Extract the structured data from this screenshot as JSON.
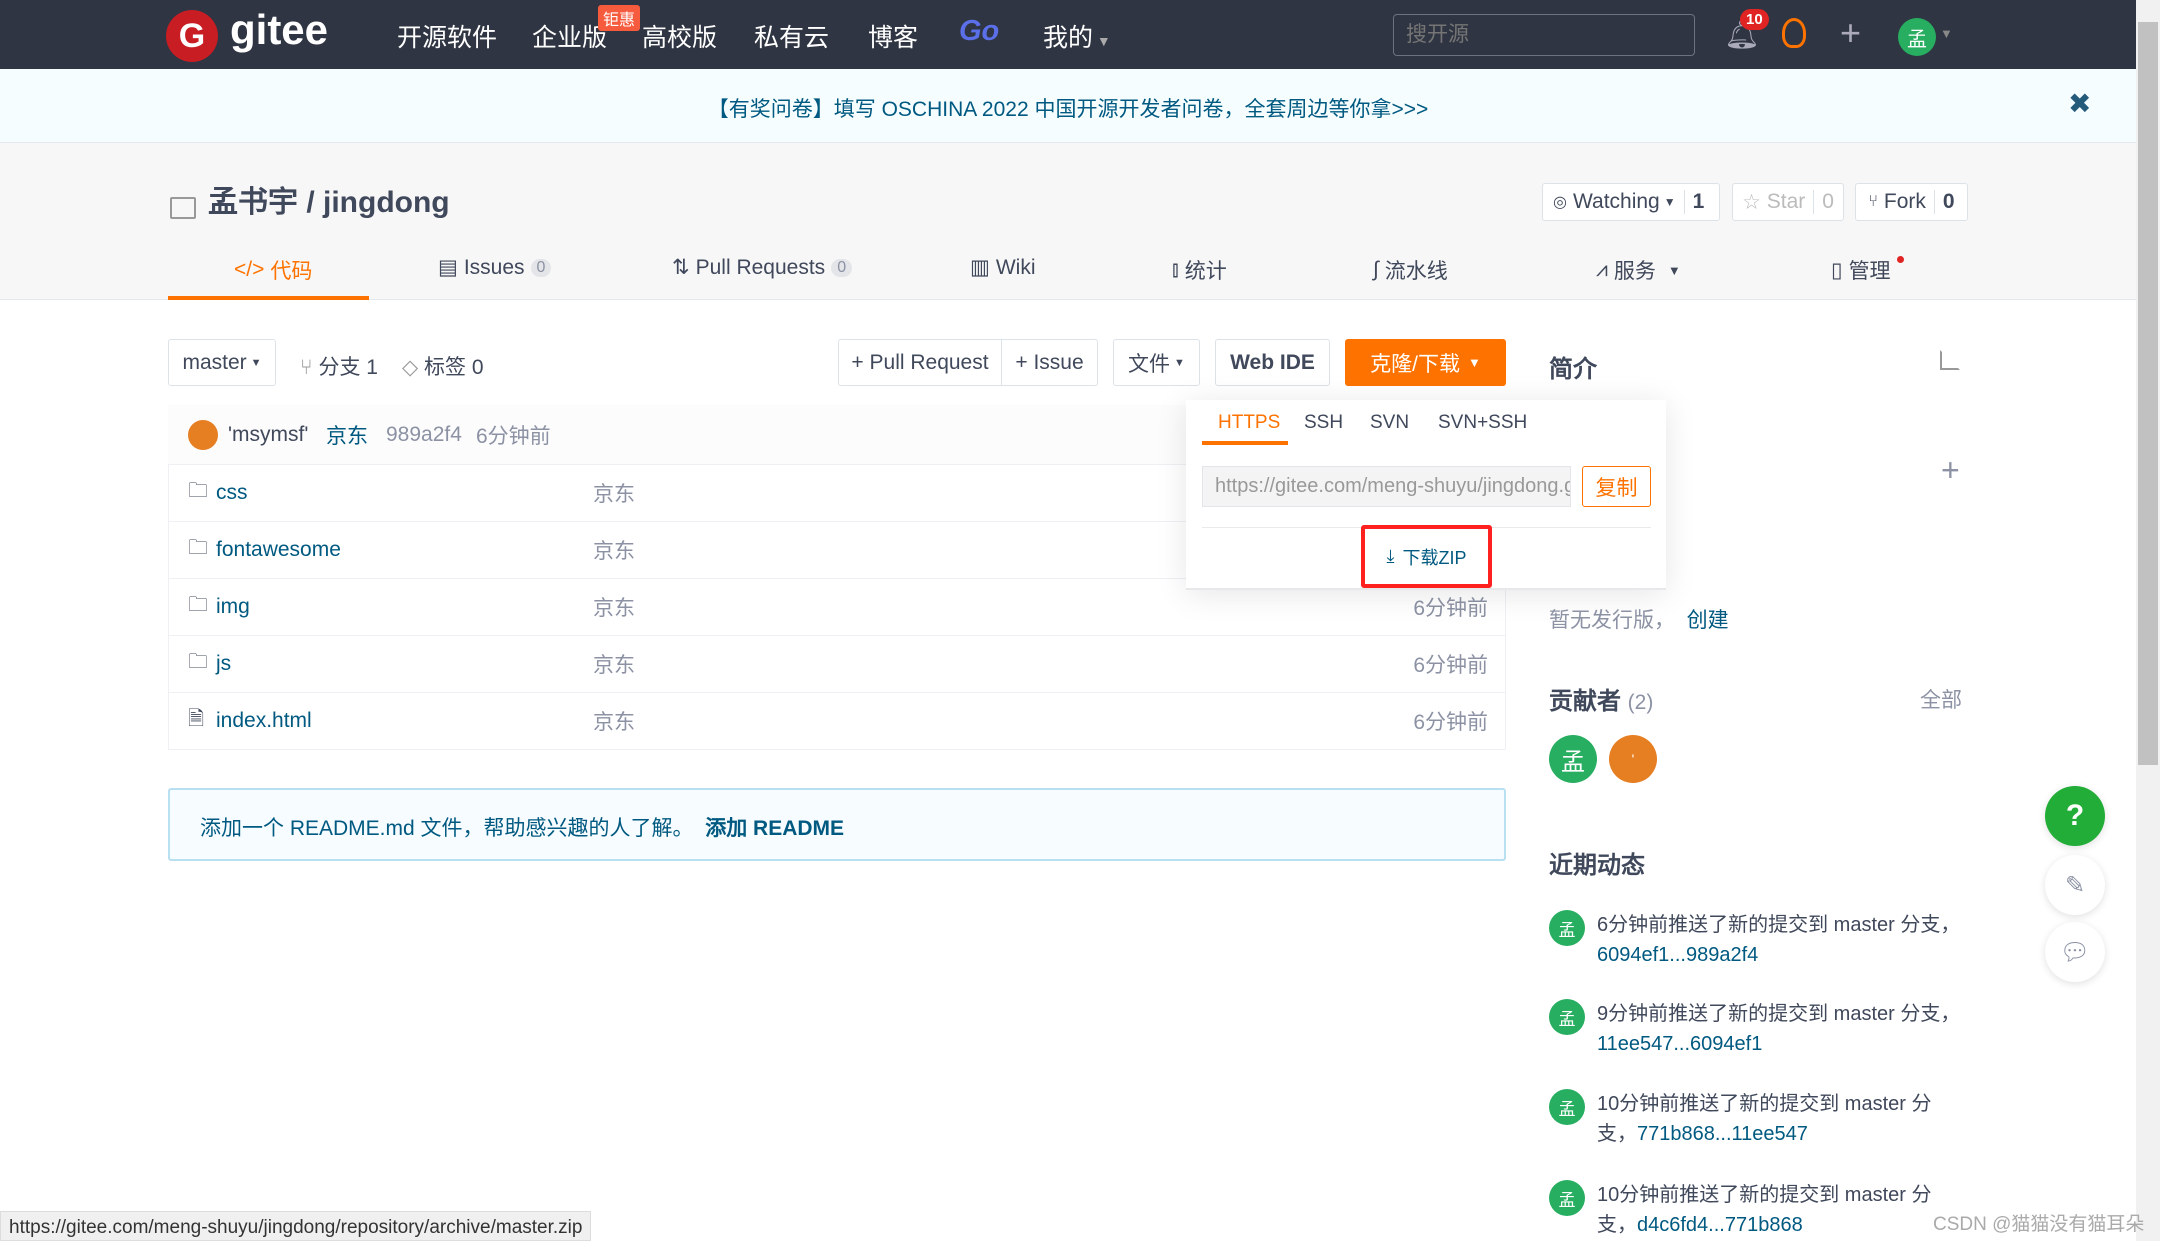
{
  "nav": {
    "logo_text": "gitee",
    "items": [
      "开源软件",
      "企业版",
      "高校版",
      "私有云",
      "博客",
      "Go",
      "我的"
    ],
    "promo_badge": "钜惠",
    "search_placeholder": "搜开源",
    "notification_count": "10",
    "avatar_initial": "孟"
  },
  "banner": {
    "text": "【有奖问卷】填写 OSCHINA 2022 中国开源开发者问卷，全套周边等你拿>>>"
  },
  "repo": {
    "owner": "孟书宇",
    "separator": " / ",
    "name": "jingdong",
    "watch_label": "Watching",
    "watch_count": "1",
    "star_label": "Star",
    "star_count": "0",
    "fork_label": "Fork",
    "fork_count": "0"
  },
  "tabs": [
    {
      "label": "代码"
    },
    {
      "label": "Issues",
      "count": "0"
    },
    {
      "label": "Pull Requests",
      "count": "0"
    },
    {
      "label": "Wiki"
    },
    {
      "label": "统计"
    },
    {
      "label": "流水线"
    },
    {
      "label": "服务"
    },
    {
      "label": "管理"
    }
  ],
  "toolbar": {
    "branch": "master",
    "branches": "分支 1",
    "tags": "标签 0",
    "pull_request": "+ Pull Request",
    "issue": "+ Issue",
    "file": "文件",
    "web_ide": "Web IDE",
    "clone": "克隆/下载"
  },
  "commit": {
    "author": "'msymsf'",
    "message": "京东",
    "hash": "989a2f4",
    "time": "6分钟前"
  },
  "files": [
    {
      "name": "css",
      "type": "folder",
      "message": "京东",
      "time": ""
    },
    {
      "name": "fontawesome",
      "type": "folder",
      "message": "京东",
      "time": ""
    },
    {
      "name": "img",
      "type": "folder",
      "message": "京东",
      "time": "6分钟前"
    },
    {
      "name": "js",
      "type": "folder",
      "message": "京东",
      "time": "6分钟前"
    },
    {
      "name": "index.html",
      "type": "file",
      "message": "京东",
      "time": "6分钟前"
    }
  ],
  "readme": {
    "text": "添加一个 README.md 文件，帮助感兴趣的人了解。",
    "link": "添加 README"
  },
  "clone_dropdown": {
    "tabs": [
      "HTTPS",
      "SSH",
      "SVN",
      "SVN+SSH"
    ],
    "active": "HTTPS",
    "url": "https://gitee.com/meng-shuyu/jingdong.git",
    "copy": "复制",
    "download_zip": "下载ZIP"
  },
  "sidebar": {
    "intro_title": "简介",
    "release_text": "暂无发行版，",
    "release_create": "创建",
    "contributors_title": "贡献者",
    "contributors_count": "(2)",
    "contributors_all": "全部",
    "contributors": [
      "孟",
      "'"
    ],
    "activity_title": "近期动态",
    "activity": [
      {
        "text": "6分钟前推送了新的提交到 master 分支，",
        "range": "6094ef1...989a2f4"
      },
      {
        "text": "9分钟前推送了新的提交到 master 分支，",
        "range": "11ee547...6094ef1"
      },
      {
        "text": "10分钟前推送了新的提交到 master 分支，",
        "range": "771b868...11ee547"
      },
      {
        "text": "10分钟前推送了新的提交到 master 分支，",
        "range": "d4c6fd4...771b868"
      }
    ]
  },
  "status_bar": {
    "url": "https://gitee.com/meng-shuyu/jingdong/repository/archive/master.zip"
  },
  "watermark": "CSDN @猫猫没有猫耳朵",
  "colors": {
    "nav_bg": "#2f3542",
    "accent": "#fe7300",
    "link": "#005980",
    "green": "#27ae60",
    "highlight": "#ff2020"
  }
}
